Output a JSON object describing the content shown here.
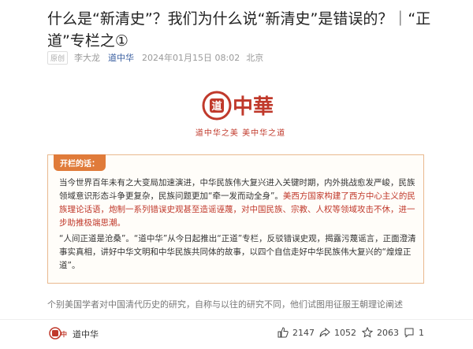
{
  "article": {
    "title": "什么是“新清史”？我们为什么说“新清史”是错误的？｜“正道”专栏之①",
    "tag": "原创",
    "author": "李大龙",
    "source": "道中华",
    "datetime": "2024年01月15日 08:02",
    "location": "北京"
  },
  "logo": {
    "brand_text": "道中華",
    "slogan": "道中华之美 美中华之道"
  },
  "intro": {
    "heading": "开栏的话：",
    "p1_a": "当今世界百年未有之大变局加速演进，中华民族伟大复兴进入关键时期，内外挑战愈发严峻，民族领域意识形态斗争更复杂，民族问题更加“牵一发而动全身”。",
    "p1_b": "美西方国家构建了西方中心主义的民族理论话语，炮制一系列错误史观甚至造谣诬蔑，对中国民族、宗教、人权等领域攻击不休，进一步助推极端思潮。",
    "p2": "“人间正道是沧桑”。“道中华”从今日起推出“正道”专栏，反驳错误史观，揭露污蔑谣言，正面澄清事实真相，讲好中华文明和中华民族共同体的故事，以四个自信走好中华民族伟大复兴的“煌煌正道”。"
  },
  "excerpt": "个别美国学者对中国清代历史的研究，自称与以往的研究不同，他们试图用征服王朝理论阐述",
  "footer": {
    "account_name": "道中华",
    "likes": "2147",
    "shares": "1052",
    "favorites": "2063",
    "comments": "1"
  },
  "colors": {
    "accent_red": "#c0392b",
    "intro_orange": "#e07b3a",
    "link_blue": "#3a5fa0"
  }
}
